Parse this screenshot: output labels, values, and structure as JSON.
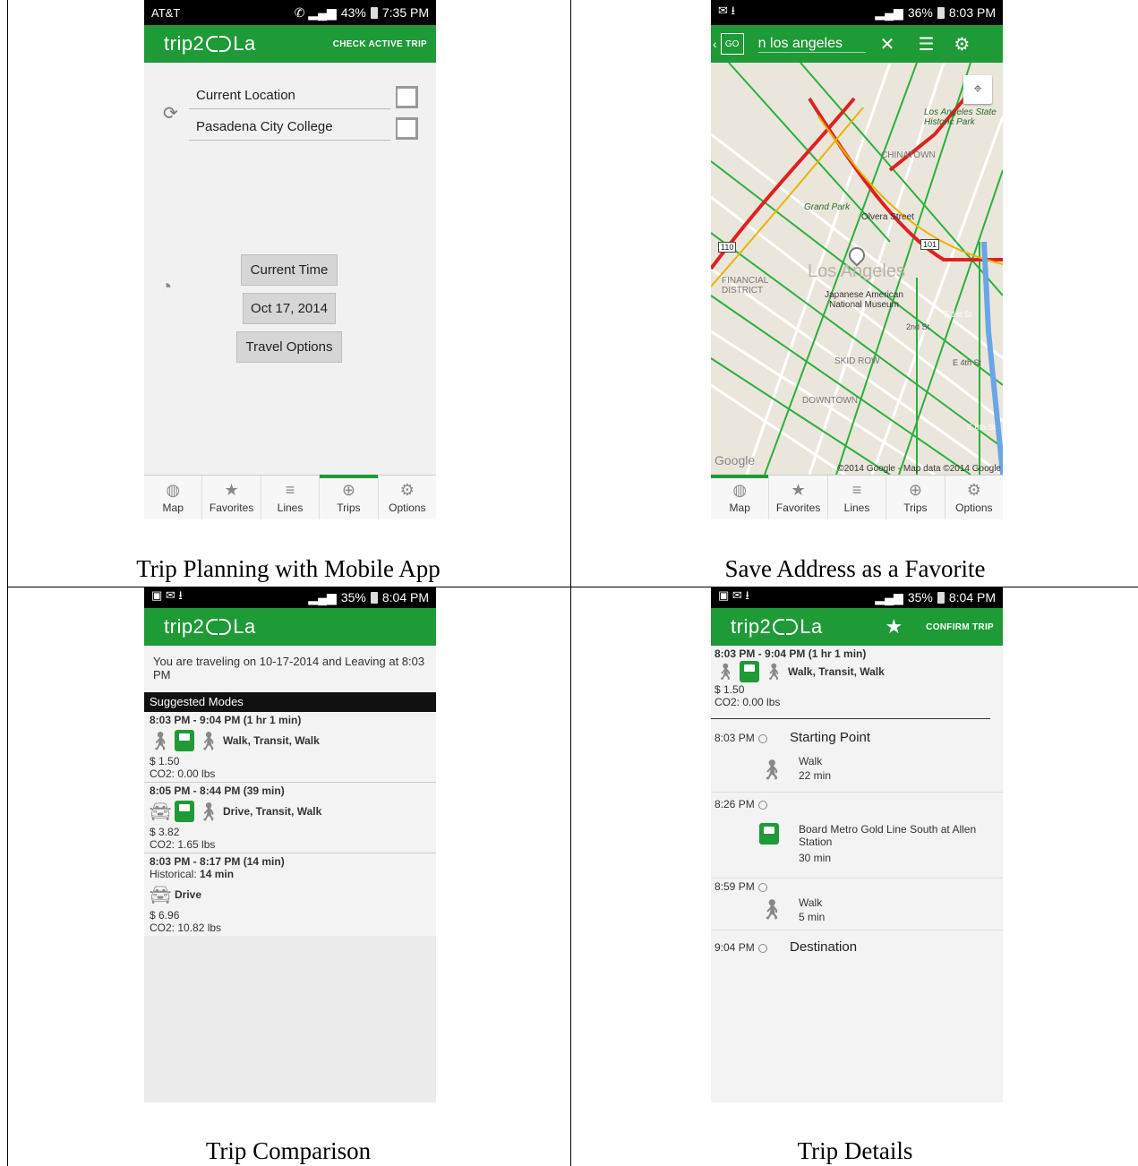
{
  "captions": {
    "tl": "Trip Planning with Mobile App",
    "tr": "Save Address as a Favorite",
    "bl": "Trip Comparison",
    "br": "Trip Details"
  },
  "tabs": [
    "Map",
    "Favorites",
    "Lines",
    "Trips",
    "Options"
  ],
  "app": {
    "logo_a": "trip2",
    "logo_b": "La"
  },
  "p1": {
    "carrier": "AT&T",
    "battery": "43%",
    "time": "7:35 PM",
    "action": "CHECK ACTIVE TRIP",
    "from": "Current Location",
    "to": "Pasadena City College",
    "time_btn": "Current Time",
    "date_btn": "Oct 17, 2014",
    "opts_btn": "Travel Options"
  },
  "p2": {
    "battery": "36%",
    "time": "8:03 PM",
    "search": "n los angeles",
    "map_labels": {
      "la": "Los Angeles",
      "state_park": "Los Angeles State Historic Park",
      "chinatown": "CHINATOWN",
      "grand_park": "Grand Park",
      "olvera": "Olvera Street",
      "financial": "FINANCIAL DISTRICT",
      "museum": "Japanese American National Museum",
      "skid": "SKID ROW",
      "downtown": "DOWNTOWN",
      "second": "2nd St",
      "first": "E 1st St",
      "fourth": "E 4th St",
      "sixth": "E 6th St",
      "google": "Google",
      "copyright": "©2014 Google - Map data ©2014 Google",
      "r110": "110",
      "r101": "101"
    }
  },
  "p3": {
    "battery": "35%",
    "time": "8:04 PM",
    "intro": "You are traveling on 10-17-2014 and Leaving at 8:03 PM",
    "section": "Suggested Modes",
    "trips": [
      {
        "time": "8:03 PM - 9:04 PM (1 hr 1 min)",
        "modes": "Walk, Transit, Walk",
        "cost": "$ 1.50",
        "co2": "CO2: 0.00 lbs"
      },
      {
        "time": "8:05 PM - 8:44 PM (39 min)",
        "modes": "Drive, Transit, Walk",
        "cost": "$ 3.82",
        "co2": "CO2: 1.65 lbs"
      },
      {
        "time": "8:03 PM - 8:17 PM (14 min)",
        "hist_label": "Historical:",
        "hist_val": "14 min",
        "modes": "Drive",
        "cost": "$ 6.96",
        "co2": "CO2: 10.82 lbs"
      }
    ]
  },
  "p4": {
    "battery": "35%",
    "time": "8:04 PM",
    "action": "CONFIRM TRIP",
    "summary": {
      "time": "8:03 PM - 9:04 PM (1 hr 1 min)",
      "modes": "Walk, Transit, Walk",
      "cost": "$ 1.50",
      "co2": "CO2: 0.00 lbs"
    },
    "steps": [
      {
        "time": "8:03 PM",
        "title": "Starting Point",
        "mode": "Walk",
        "dur": "22 min"
      },
      {
        "time": "8:26 PM",
        "desc": "Board Metro Gold Line South at Allen Station",
        "dur": "30 min"
      },
      {
        "time": "8:59 PM",
        "mode": "Walk",
        "dur": "5 min"
      },
      {
        "time": "9:04 PM",
        "title": "Destination"
      }
    ]
  },
  "colors": {
    "brand": "#1e9a36"
  }
}
